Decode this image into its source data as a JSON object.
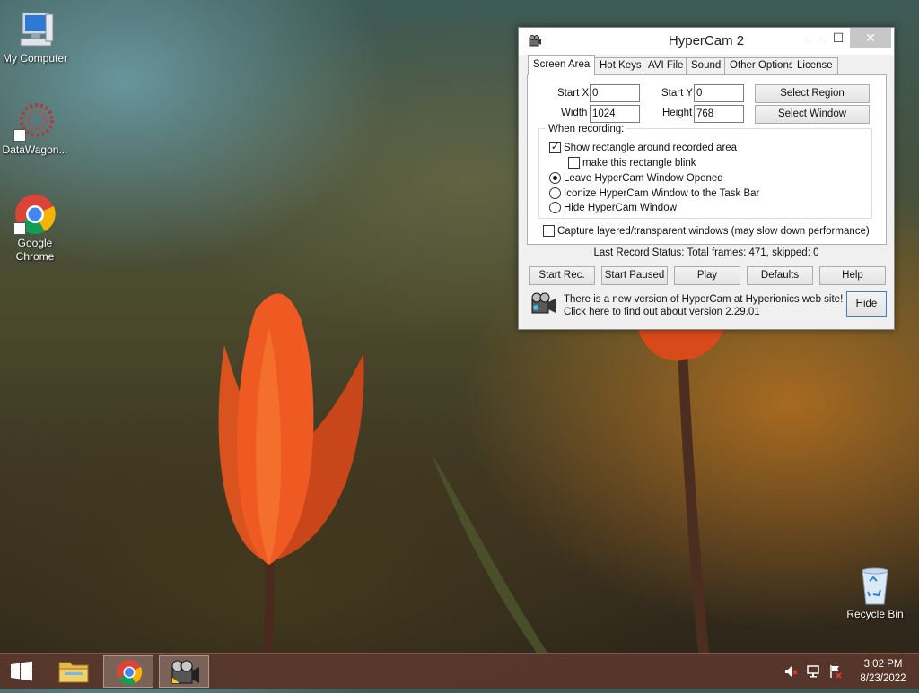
{
  "desktop": {
    "icons": [
      {
        "label": "My Computer",
        "icon": "computer-icon"
      },
      {
        "label": "DataWagon...",
        "icon": "datawagon-icon"
      },
      {
        "label": "Google Chrome",
        "icon": "chrome-icon"
      },
      {
        "label": "Recycle Bin",
        "icon": "recycle-bin-icon"
      }
    ]
  },
  "window": {
    "title": "HyperCam 2",
    "controls": {
      "minimize": "—",
      "maximize": "☐",
      "close": "✕"
    },
    "tabs": [
      "Screen Area",
      "Hot Keys",
      "AVI File",
      "Sound",
      "Other Options",
      "License"
    ],
    "active_tab": "Screen Area",
    "screen_area": {
      "start_x_label": "Start X",
      "start_x_value": "0",
      "start_y_label": "Start Y",
      "start_y_value": "0",
      "width_label": "Width",
      "width_value": "1024",
      "height_label": "Height",
      "height_value": "768",
      "select_region_label": "Select Region",
      "select_window_label": "Select Window",
      "when_recording_title": "When recording:",
      "show_rectangle_label": "Show rectangle around recorded area",
      "show_rectangle_checked": true,
      "blink_label": "make this rectangle blink",
      "blink_checked": false,
      "radio_options": [
        "Leave HyperCam Window Opened",
        "Iconize HyperCam Window to the Task Bar",
        "Hide HyperCam Window"
      ],
      "radio_selected": "Leave HyperCam Window Opened",
      "capture_layered_label": "Capture layered/transparent windows (may slow down performance)",
      "capture_layered_checked": false
    },
    "status": "Last Record Status: Total frames: 471, skipped: 0",
    "buttons": {
      "start_rec": "Start Rec.",
      "start_paused": "Start Paused",
      "play": "Play",
      "defaults": "Defaults",
      "help": "Help"
    },
    "update_message": "There is a new version of HyperCam at Hyperionics web site! Click here to find out about version 2.29.01",
    "hide_label": "Hide"
  },
  "taskbar": {
    "items": [
      "start-icon",
      "file-explorer-icon",
      "chrome-icon",
      "hypercam-icon"
    ],
    "active_items": [
      "chrome-icon",
      "hypercam-icon"
    ],
    "tray": [
      "volume-muted-icon",
      "network-icon",
      "action-center-flag-icon"
    ],
    "time": "3:02 PM",
    "date": "8/23/2022"
  },
  "colors": {
    "taskbar": "#5a372d",
    "close_button": "#c7c7c7",
    "window_bg": "#f0f0f0"
  }
}
